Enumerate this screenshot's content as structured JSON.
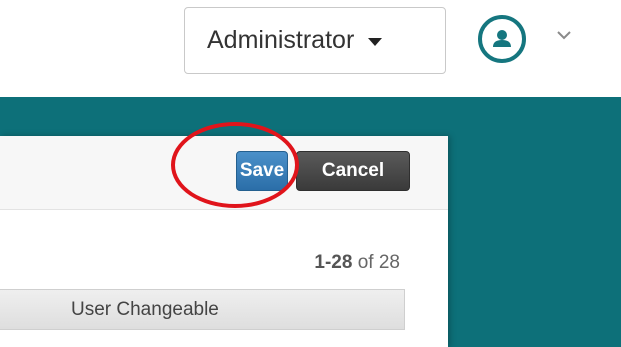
{
  "header": {
    "role_selector": {
      "label": "Administrator",
      "icon": "caret-down-icon"
    },
    "user_menu": {
      "avatar_icon": "user-avatar-icon",
      "chevron_icon": "chevron-down-icon",
      "accent_color": "#15767f"
    }
  },
  "panel": {
    "actions": {
      "save_label": "Save",
      "cancel_label": "Cancel"
    },
    "pager": {
      "range": "1-28",
      "of_label": "of",
      "total": "28"
    },
    "table": {
      "columns": [
        "User Changeable"
      ]
    }
  },
  "colors": {
    "band": "#0d7079",
    "save_button": "#2f78b5",
    "cancel_button": "#4a4a4a",
    "highlight": "#e0141b"
  }
}
